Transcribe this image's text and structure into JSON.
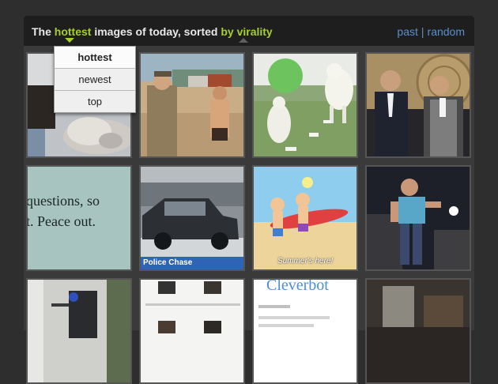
{
  "header": {
    "prefix": "The ",
    "sort_active": "hottest",
    "middle": " images of today, sorted ",
    "sort_by": "by virality",
    "links": {
      "past": "past",
      "separator": "|",
      "random": "random"
    }
  },
  "dropdown": {
    "options": [
      "hottest",
      "newest",
      "top"
    ],
    "selected": "hottest"
  },
  "tiles": {
    "questions_text_line1": "questions, so",
    "questions_text_line2": "t. Peace out.",
    "police_caption": "Police Chase",
    "summer_caption": "Summer's here!",
    "cleverbot_caption": "Cleverbot"
  },
  "colors": {
    "accent": "#a5cf2a",
    "link": "#5a8fd0",
    "background": "#2e2e2e"
  }
}
